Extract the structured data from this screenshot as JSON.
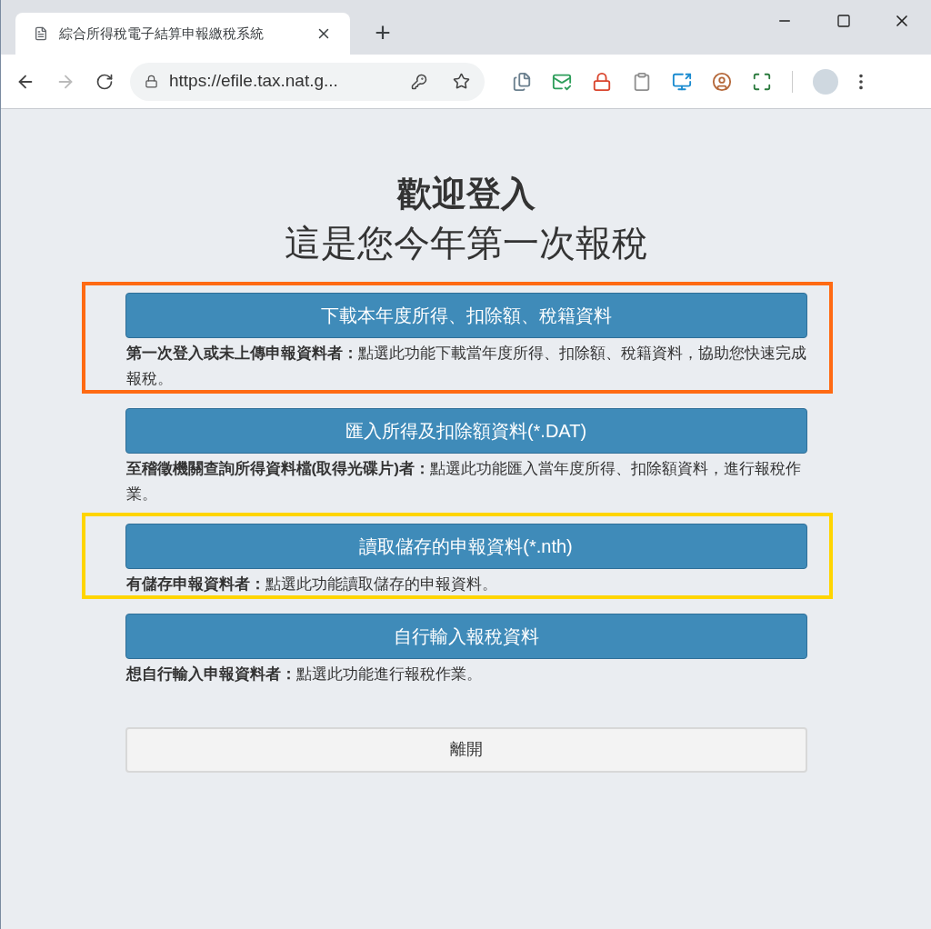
{
  "browser": {
    "tab": {
      "title": "綜合所得稅電子結算申報繳稅系統",
      "selected": true
    },
    "new_tab": "+",
    "url": "https://efile.tax.nat.g..."
  },
  "page": {
    "heading": "歡迎登入",
    "subheading": "這是您今年第一次報稅",
    "options": [
      {
        "button": "下載本年度所得、扣除額、稅籍資料",
        "description": "**第一次登入或未上傳申報資料者：**點選此功能下載當年度所得、扣除額、稅籍資料，協助您快速完成報稅。",
        "color": "#ff6a13"
      },
      {
        "button": "匯入所得及扣除額資料(*.DAT)",
        "description": "**至稽徵機關查詢所得資料檔(取得光碟片)者：**點選此功能匯入當年度所得、扣除額資料，進行報稅作業。"
      },
      {
        "button": "讀取儲存的申報資料(*.nth)",
        "description": "**有儲存申報資料者：**點選此功能讀取儲存的申報資料。",
        "color": "#ffd500"
      },
      {
        "button": "自行輸入報稅資料",
        "description": "**想自行輸入申報資料者：**點選此功能進行報稅作業。"
      }
    ],
    "exit_button": "離開"
  }
}
